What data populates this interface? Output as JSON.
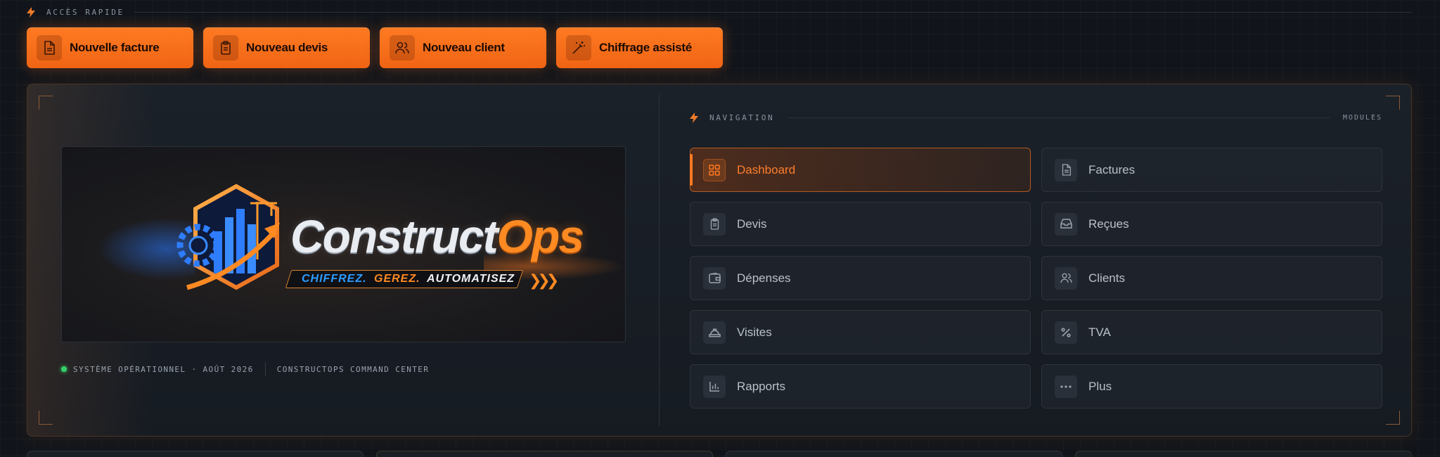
{
  "quick_access": {
    "title": "ACCÈS RAPIDE",
    "buttons": [
      {
        "label": "Nouvelle facture",
        "icon": "file-text-icon"
      },
      {
        "label": "Nouveau devis",
        "icon": "clipboard-icon"
      },
      {
        "label": "Nouveau client",
        "icon": "users-icon"
      },
      {
        "label": "Chiffrage assisté",
        "icon": "magic-wand-icon"
      }
    ]
  },
  "brand": {
    "word_part1": "Construct",
    "word_part2": "Ops",
    "tagline_part1": "CHIFFREZ.",
    "tagline_part2": "GEREZ.",
    "tagline_part3": "AUTOMATISEZ"
  },
  "status": {
    "system": "SYSTÈME OPÉRATIONNEL · AOÛT 2026",
    "center": "CONSTRUCTOPS COMMAND CENTER"
  },
  "navigation": {
    "title": "NAVIGATION",
    "modules_label": "MODULES",
    "items": [
      {
        "label": "Dashboard",
        "icon": "grid-icon",
        "active": true
      },
      {
        "label": "Factures",
        "icon": "file-text-icon",
        "active": false
      },
      {
        "label": "Devis",
        "icon": "clipboard-icon",
        "active": false
      },
      {
        "label": "Reçues",
        "icon": "inbox-icon",
        "active": false
      },
      {
        "label": "Dépenses",
        "icon": "wallet-icon",
        "active": false
      },
      {
        "label": "Clients",
        "icon": "users-icon",
        "active": false
      },
      {
        "label": "Visites",
        "icon": "hard-hat-icon",
        "active": false
      },
      {
        "label": "TVA",
        "icon": "percent-icon",
        "active": false
      },
      {
        "label": "Rapports",
        "icon": "bar-chart-icon",
        "active": false
      },
      {
        "label": "Plus",
        "icon": "more-icon",
        "active": false
      }
    ]
  },
  "colors": {
    "accent": "#ff7a22",
    "background": "#11151b",
    "status_ok": "#35d06a",
    "brand_blue": "#2e9cff"
  }
}
